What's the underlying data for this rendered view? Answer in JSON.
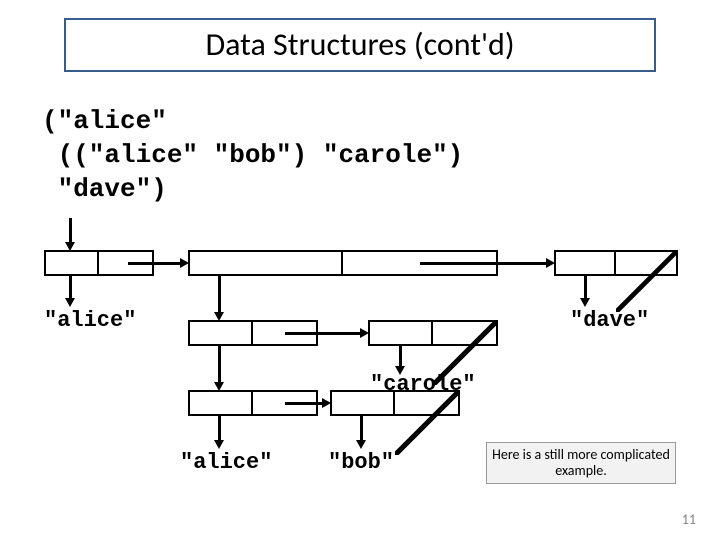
{
  "title": "Data Structures (cont'd)",
  "sexpr": "(\"alice\"\n ((\"alice\" \"bob\") \"carole\")\n \"dave\")",
  "labels": {
    "alice1": "\"alice\"",
    "dave": "\"dave\"",
    "carole": "\"carole\"",
    "alice2": "\"alice\"",
    "bob": "\"bob\""
  },
  "note": "Here is a still more complicated example.",
  "pagenum": "11",
  "chart_data": {
    "type": "table",
    "description": "Box-and-pointer diagram of nested Lisp list",
    "list": [
      "alice",
      [
        [
          "alice",
          "bob"
        ],
        "carole"
      ],
      "dave"
    ],
    "nodes": [
      {
        "id": "c1",
        "car": "alice",
        "cdr": "c2"
      },
      {
        "id": "c2",
        "car": "c4",
        "cdr": "c3"
      },
      {
        "id": "c3",
        "car": "dave",
        "cdr": null
      },
      {
        "id": "c4",
        "car": "c6",
        "cdr": "c5"
      },
      {
        "id": "c5",
        "car": "carole",
        "cdr": null
      },
      {
        "id": "c6",
        "car": "alice",
        "cdr": "c7"
      },
      {
        "id": "c7",
        "car": "bob",
        "cdr": null
      }
    ]
  }
}
